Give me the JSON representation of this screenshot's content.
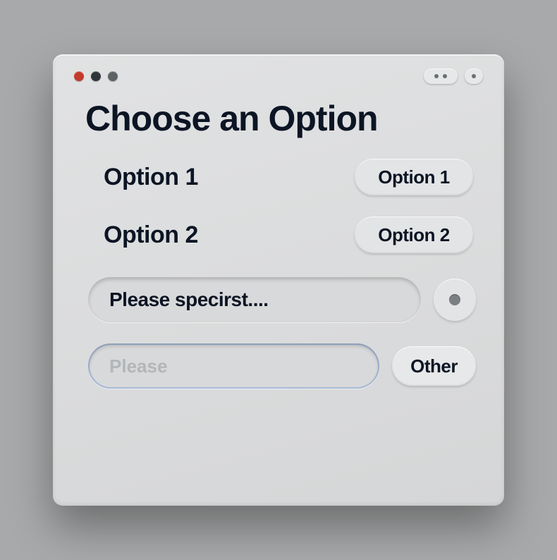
{
  "title": "Choose an Option",
  "options": [
    {
      "label": "Option 1",
      "button": "Option 1"
    },
    {
      "label": "Option 2",
      "button": "Option 2"
    }
  ],
  "specify": {
    "text": "Please specirst...."
  },
  "input": {
    "placeholder": "Please",
    "value": ""
  },
  "other_button": "Other"
}
